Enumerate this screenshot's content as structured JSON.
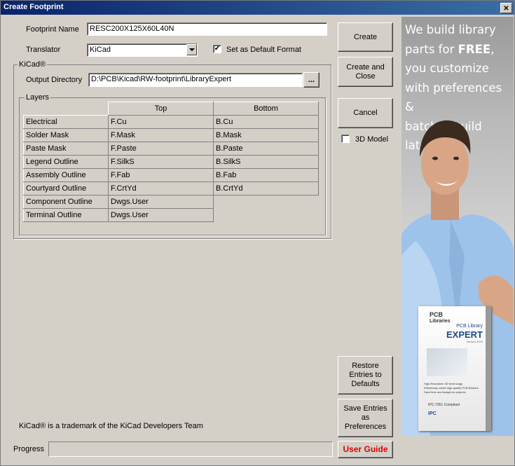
{
  "window": {
    "title": "Create Footprint",
    "close_label": "✕"
  },
  "form": {
    "footprint_name_label": "Footprint Name",
    "footprint_name_value": "RESC200X125X60L40N",
    "translator_label": "Translator",
    "translator_value": "KiCad",
    "default_format_label": "Set as Default Format",
    "default_format_checked": "✔"
  },
  "kicad_group": {
    "label": "KiCad®",
    "output_dir_label": "Output Directory",
    "output_dir_value": "D:\\PCB\\Kicad\\RW-footprint\\LibraryExpert",
    "browse_label": "..."
  },
  "layers": {
    "group_label": "Layers",
    "col_top": "Top",
    "col_bottom": "Bottom",
    "rows": [
      {
        "name": "Electrical",
        "top": "F.Cu",
        "bottom": "B.Cu"
      },
      {
        "name": "Solder Mask",
        "top": "F.Mask",
        "bottom": "B.Mask"
      },
      {
        "name": "Paste Mask",
        "top": "F.Paste",
        "bottom": "B.Paste"
      },
      {
        "name": "Legend Outline",
        "top": "F.SilkS",
        "bottom": "B.SilkS"
      },
      {
        "name": "Assembly Outline",
        "top": "F.Fab",
        "bottom": "B.Fab"
      },
      {
        "name": "Courtyard Outline",
        "top": "F.CrtYd",
        "bottom": "B.CrtYd"
      },
      {
        "name": "Component Outline",
        "top": "Dwgs.User",
        "bottom": ""
      },
      {
        "name": "Terminal Outline",
        "top": "Dwgs.User",
        "bottom": ""
      }
    ]
  },
  "buttons": {
    "create": "Create",
    "create_close_1": "Create and",
    "create_close_2": "Close",
    "cancel": "Cancel",
    "model_3d_label": "3D Model",
    "restore_1": "Restore",
    "restore_2": "Entries to",
    "restore_3": "Defaults",
    "save_1": "Save Entries",
    "save_2": "as",
    "save_3": "Preferences",
    "user_guide": "User Guide"
  },
  "footer": {
    "trademark": "KiCad® is a trademark of the KiCad Developers Team",
    "progress_label": "Progress"
  },
  "ad": {
    "line1": "We build library",
    "line2a": "parts for ",
    "line2b": "FREE",
    "line2c": ",",
    "line3": "you customize",
    "line4": "with preferences &",
    "line5": "batch-rebuild later!",
    "box_brand1": "PCB",
    "box_brand2": "Libraries",
    "box_title1": "PCB Library",
    "box_title2": "EXPERT",
    "box_version": "Version 2015",
    "box_bullet1": "High-Resolution 3D technology",
    "box_bullet2": "Effortlessly create high-quality PCB libraries",
    "box_bullet3": "Save time and budget on projects",
    "box_compliance": "IPC-7351 Compliant",
    "box_ipc": "IPC"
  },
  "colors": {
    "user_guide_text": "#e00000",
    "titlebar": "#0a246a"
  }
}
